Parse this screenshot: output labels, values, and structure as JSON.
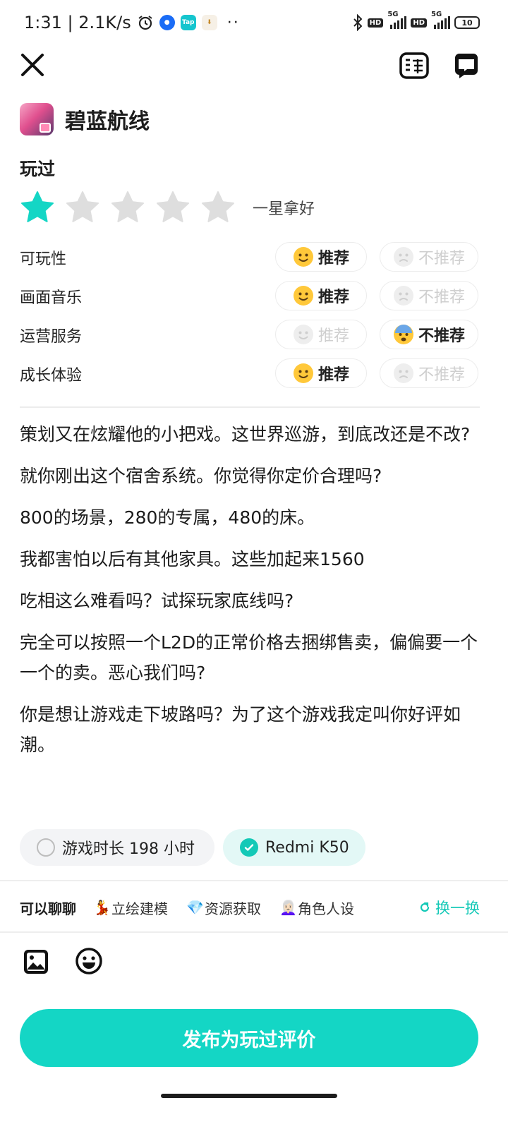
{
  "status_bar": {
    "time_speed": "1:31 | 2.1K/s",
    "app_icons": [
      "alarm-icon",
      "app-blue-icon",
      "taptap-icon",
      "download-icon"
    ],
    "hd1": "HD",
    "net1": "5G",
    "hd2": "HD",
    "net2": "5G",
    "battery": "10"
  },
  "header": {
    "close_icon": "close-icon",
    "rules_icon": "rating-rules-icon",
    "chat_icon": "chat-icon"
  },
  "game": {
    "title": "碧蓝航线"
  },
  "played_label": "玩过",
  "rating": {
    "value": 1,
    "max": 5,
    "text": "一星拿好",
    "active_color": "#14d6c5",
    "inactive_color": "#dedede"
  },
  "aspects": [
    {
      "label": "可玩性",
      "recommend": "推荐",
      "not_recommend": "不推荐",
      "choice": "recommend"
    },
    {
      "label": "画面音乐",
      "recommend": "推荐",
      "not_recommend": "不推荐",
      "choice": "recommend"
    },
    {
      "label": "运营服务",
      "recommend": "推荐",
      "not_recommend": "不推荐",
      "choice": "not_recommend"
    },
    {
      "label": "成长体验",
      "recommend": "推荐",
      "not_recommend": "不推荐",
      "choice": "recommend"
    }
  ],
  "review": {
    "paragraphs": [
      "策划又在炫耀他的小把戏。这世界巡游，到底改还是不改?",
      "就你刚出这个宿舍系统。你觉得你定价合理吗?",
      "800的场景，280的专属，480的床。",
      "我都害怕以后有其他家具。这些加起来1560",
      "吃相这么难看吗？试探玩家底线吗?",
      "完全可以按照一个L2D的正常价格去捆绑售卖，偏偏要一个一个的卖。恶心我们吗?",
      "你是想让游戏走下坡路吗？为了这个游戏我定叫你好评如潮。"
    ]
  },
  "tags": {
    "playtime": "游戏时长 198 小时",
    "device": "Redmi K50"
  },
  "topics": {
    "lead": "可以聊聊",
    "items": [
      {
        "emoji": "💃",
        "label": "立绘建模"
      },
      {
        "emoji": "💎",
        "label": "资源获取"
      },
      {
        "emoji": "👩🏻‍🦳",
        "label": "角色人设"
      }
    ],
    "swap": "换一换"
  },
  "tools": {
    "image_icon": "image-icon",
    "emoji_icon": "smile-icon"
  },
  "publish_label": "发布为玩过评价",
  "colors": {
    "accent": "#14d6c5",
    "accent_text": "#14c9b7"
  }
}
